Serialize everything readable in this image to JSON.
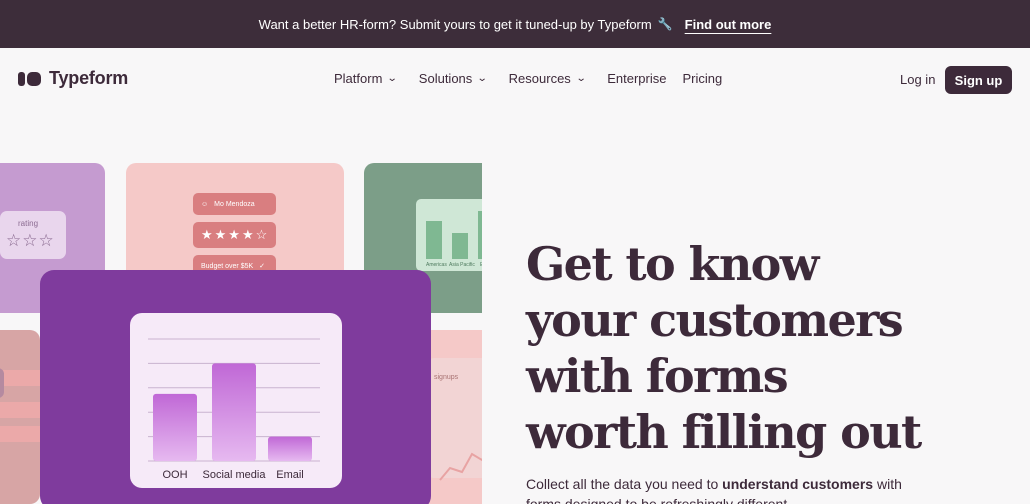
{
  "banner": {
    "message": "Want a better HR-form? Submit yours to get it tuned-up by Typeform",
    "icon": "wrench-icon",
    "cta": "Find out more"
  },
  "nav": {
    "logo_text": "Typeform",
    "items": [
      {
        "label": "Platform",
        "has_dropdown": true
      },
      {
        "label": "Solutions",
        "has_dropdown": true
      },
      {
        "label": "Resources",
        "has_dropdown": true
      },
      {
        "label": "Enterprise",
        "has_dropdown": false
      },
      {
        "label": "Pricing",
        "has_dropdown": false
      }
    ],
    "login": "Log in",
    "signup": "Sign up"
  },
  "collage": {
    "rating_label": "rating",
    "rating_stars": "☆☆☆",
    "pill_name": "Mo Mendoza",
    "pill_stars": "★★★★☆",
    "pill_budget": "Budget over $5K",
    "green_labels": [
      "Americas",
      "Asia Pacific",
      "E"
    ],
    "rose_label": "signups"
  },
  "chart_data": {
    "type": "bar",
    "categories": [
      "OOH",
      "Social media",
      "Email"
    ],
    "values": [
      55,
      80,
      20
    ],
    "ylim": [
      0,
      100
    ],
    "grid": true
  },
  "hero": {
    "headline_lines": [
      "Get to know",
      "your customers",
      "with forms",
      "worth filling out"
    ],
    "subtext_pre": "Collect all the data you need to ",
    "subtext_bold": "understand customers",
    "subtext_post": " with forms designed to be refreshingly different."
  },
  "colors": {
    "banner_bg": "#3d2d3a",
    "brand_dark": "#3d2a3a",
    "purple_card": "#7f3b9d",
    "bar_fill": "#c068d6"
  }
}
